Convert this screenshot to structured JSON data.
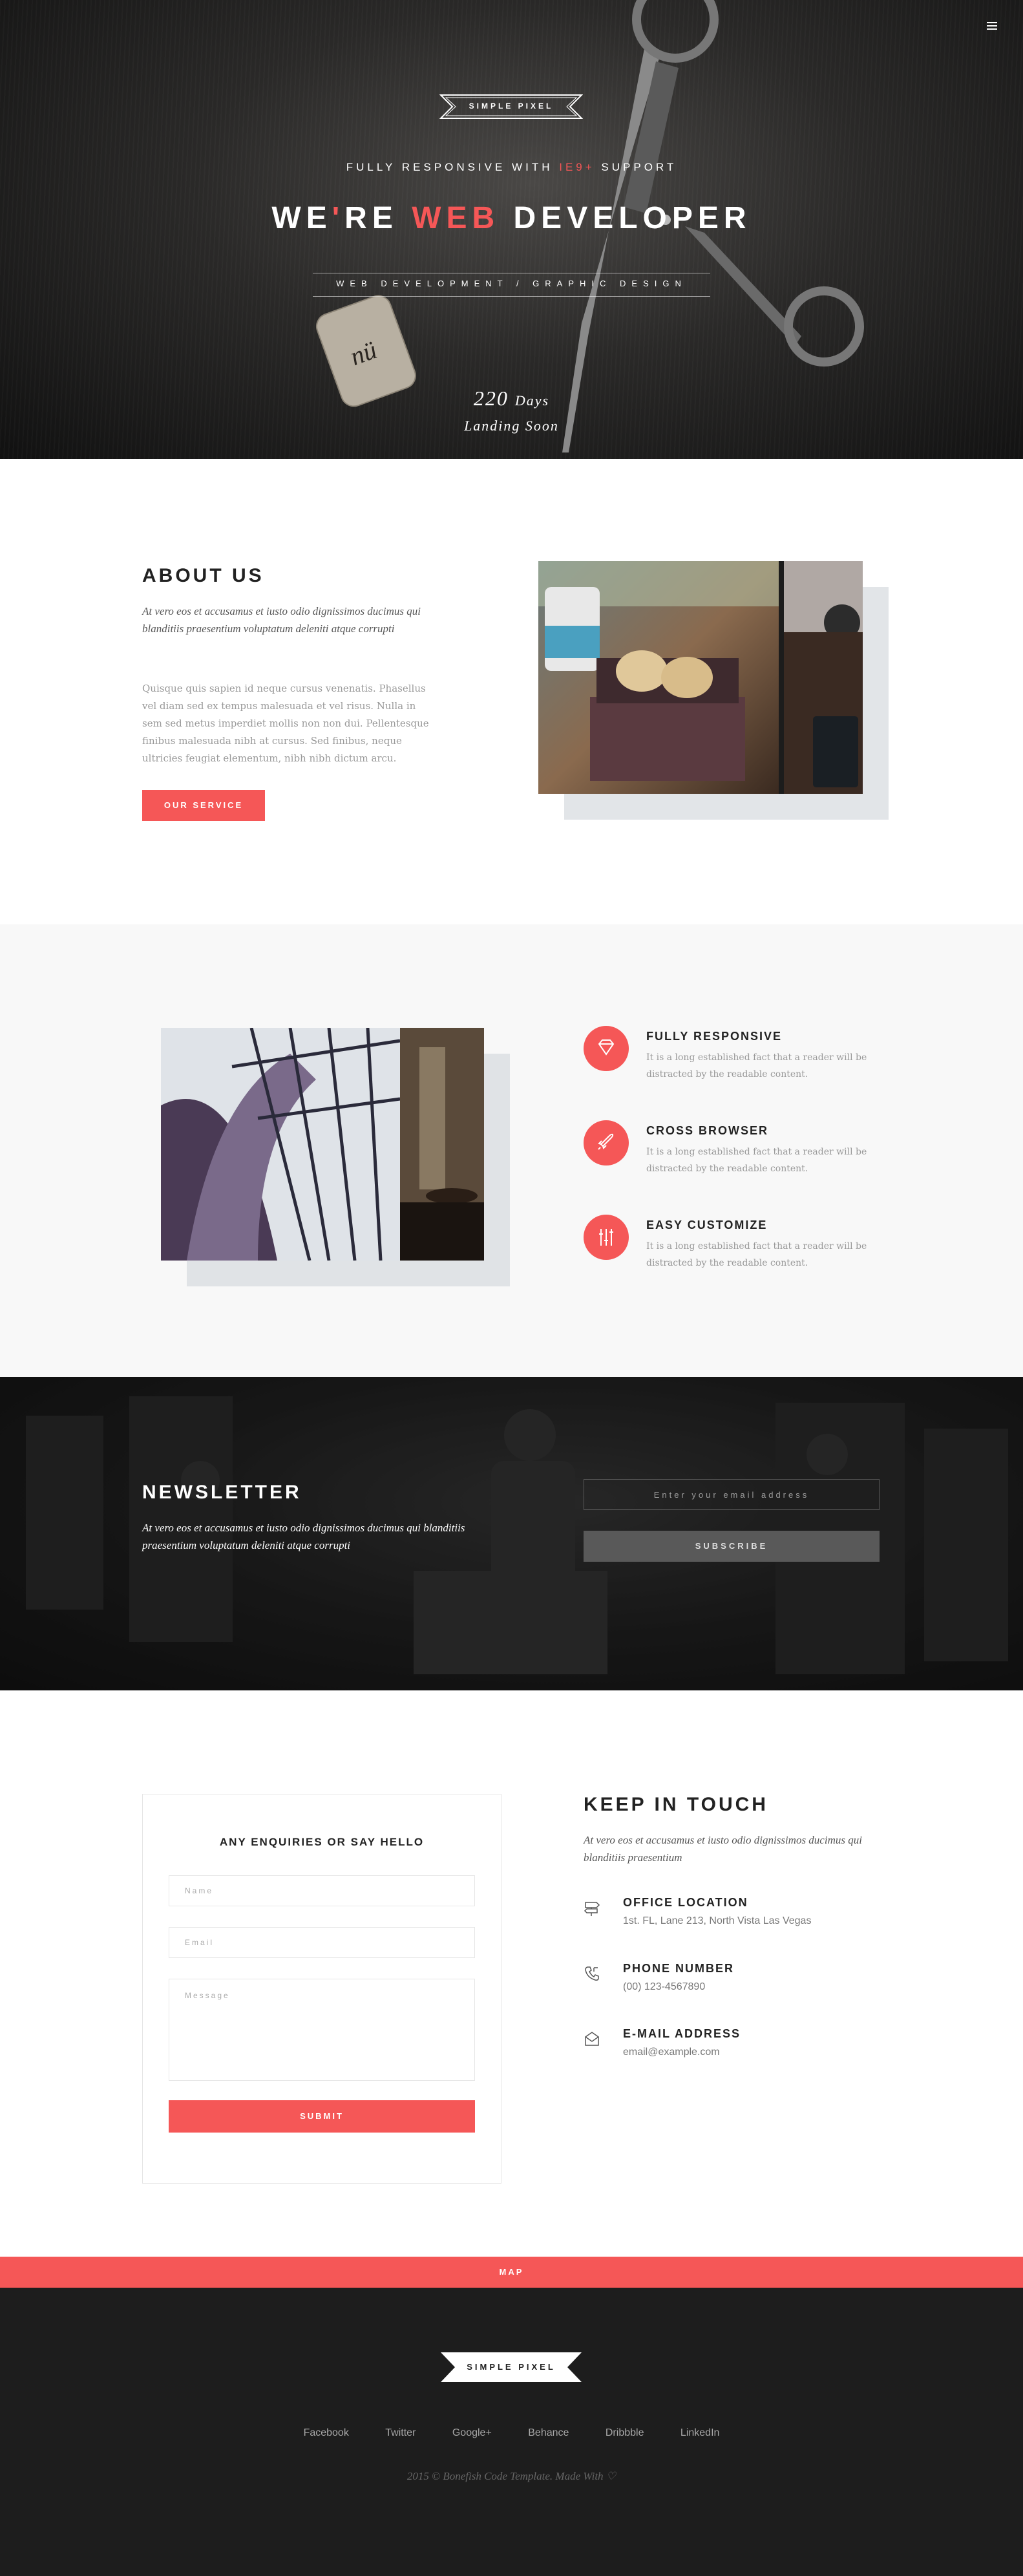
{
  "hero": {
    "brand": "SIMPLE PIXEL",
    "subtitle_pre": "FULLY RESPONSIVE WITH ",
    "subtitle_accent": "IE9+",
    "subtitle_post": " SUPPORT",
    "title_pre": "WE",
    "title_apos": "'",
    "title_mid": "RE ",
    "title_accent": "WEB",
    "title_post": " DEVELOPER",
    "tagline": "WEB DEVELOPMENT / GRAPHIC DESIGN",
    "countdown_number": "220",
    "countdown_unit": "Days",
    "landing": "Landing Soon"
  },
  "about": {
    "title": "ABOUT US",
    "lead": "At vero eos et accusamus et iusto odio dignissimos ducimus qui blanditiis praesentium voluptatum deleniti atque corrupti",
    "body": "Quisque quis sapien id neque cursus venenatis. Phasellus vel diam sed ex tempus malesuada et vel risus. Nulla in sem sed metus imperdiet mollis non non dui. Pellentesque finibus malesuada nibh at cursus. Sed finibus, neque ultricies feugiat elementum, nibh nibh dictum arcu.",
    "button": "OUR SERVICE"
  },
  "features": {
    "items": [
      {
        "icon": "diamond-icon",
        "title": "FULLY RESPONSIVE",
        "text": "It is a long established fact that a reader will be distracted by the readable content."
      },
      {
        "icon": "rocket-icon",
        "title": "CROSS BROWSER",
        "text": "It is a long established fact that a reader will be distracted by the readable content."
      },
      {
        "icon": "sliders-icon",
        "title": "EASY CUSTOMIZE",
        "text": "It is a long established fact that a reader will be distracted by the readable content."
      }
    ]
  },
  "newsletter": {
    "title": "NEWSLETTER",
    "lead": "At vero eos et accusamus et iusto odio dignissimos ducimus qui blanditiis praesentium voluptatum deleniti atque corrupti",
    "placeholder": "Enter your email address",
    "button": "SUBSCRIBE"
  },
  "contact": {
    "form_title": "ANY ENQUIRIES OR SAY HELLO",
    "name_placeholder": "Name",
    "email_placeholder": "Email",
    "message_placeholder": "Message",
    "submit": "SUBMIT",
    "title": "KEEP IN TOUCH",
    "lead": "At vero eos et accusamus et iusto odio dignissimos ducimus qui blanditiis praesentium",
    "office_title": "OFFICE LOCATION",
    "office_text": "1st. FL, Lane 213, North Vista Las Vegas",
    "phone_title": "PHONE NUMBER",
    "phone_text": "(00) 123-4567890",
    "email_title": "E-MAIL ADDRESS",
    "email_text": "email@example.com"
  },
  "map": {
    "label": "MAP"
  },
  "footer": {
    "brand": "SIMPLE PIXEL",
    "social": [
      "Facebook",
      "Twitter",
      "Google+",
      "Behance",
      "Dribbble",
      "LinkedIn"
    ],
    "copyright": "2015 © Bonefish Code Template. Made With",
    "heart": "♡"
  },
  "colors": {
    "accent": "#f55757",
    "dark": "#1d1d1d",
    "light_section": "#f8f8f8"
  }
}
